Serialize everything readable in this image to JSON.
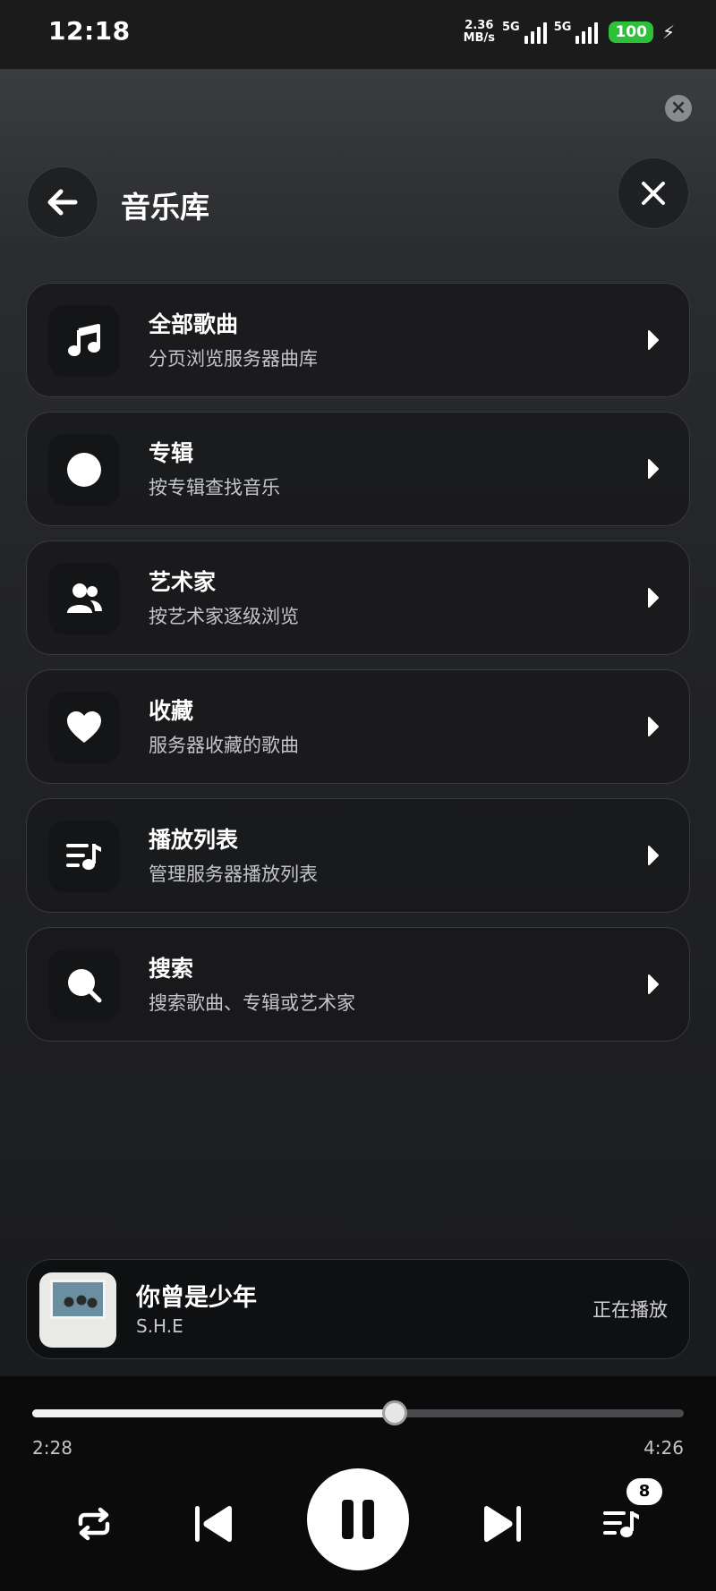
{
  "status_bar": {
    "time": "12:18",
    "net_speed_value": "2.36",
    "net_speed_unit": "MB/s",
    "sim1_label": "5G",
    "sim2_label": "5G",
    "battery": "100"
  },
  "header": {
    "title": "音乐库"
  },
  "library_items": [
    {
      "title": "全部歌曲",
      "subtitle": "分页浏览服务器曲库",
      "icon": "music-note-icon"
    },
    {
      "title": "专辑",
      "subtitle": "按专辑查找音乐",
      "icon": "album-disc-icon"
    },
    {
      "title": "艺术家",
      "subtitle": "按艺术家逐级浏览",
      "icon": "artists-icon"
    },
    {
      "title": "收藏",
      "subtitle": "服务器收藏的歌曲",
      "icon": "heart-icon"
    },
    {
      "title": "播放列表",
      "subtitle": "管理服务器播放列表",
      "icon": "playlist-icon"
    },
    {
      "title": "搜索",
      "subtitle": "搜索歌曲、专辑或艺术家",
      "icon": "search-icon"
    }
  ],
  "now_playing": {
    "title": "你曾是少年",
    "artist": "S.H.E",
    "status": "正在播放"
  },
  "player": {
    "current_time": "2:28",
    "total_time": "4:26",
    "progress": 0.556,
    "queue_count": "8"
  },
  "colors": {
    "battery": "#2fc03a",
    "panel": "#222326",
    "card": "#18191b"
  }
}
